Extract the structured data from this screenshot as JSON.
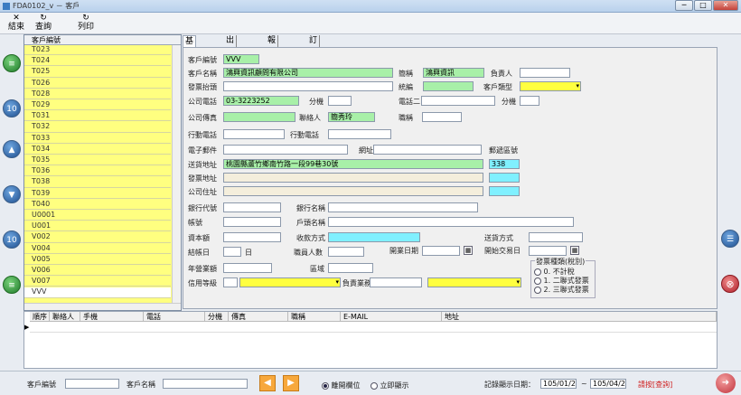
{
  "window": {
    "title": "FDA0102_v － 客戶",
    "min": "─",
    "max": "□",
    "close": "✕"
  },
  "toolbar": [
    {
      "icon": "✕",
      "label": "結束"
    },
    {
      "icon": "↻",
      "label": "查詢"
    },
    {
      "icon": "↻",
      "label": "列印"
    }
  ],
  "list": {
    "header": "客戶編號",
    "rows": [
      "T023",
      "T024",
      "T025",
      "T026",
      "T028",
      "T029",
      "T031",
      "T032",
      "T033",
      "T034",
      "T035",
      "T036",
      "T038",
      "T039",
      "T040",
      "U0001",
      "U001",
      "V002",
      "V004",
      "V005",
      "V006",
      "V007",
      "VVV"
    ]
  },
  "nav_left": {
    "top_label": "≡",
    "prev10_label": "10",
    "prev_label": "▲",
    "next_label": "▼",
    "next10_label": "10",
    "bottom_label": "≡"
  },
  "tabs": [
    "基本資料",
    "出貨記錄",
    "報價記錄",
    "訂單記錄"
  ],
  "form": {
    "cust_no_label": "客戶編號",
    "cust_no": "VVV",
    "cust_name_label": "客戶名稱",
    "cust_name": "鴻興資訊顧問有限公司",
    "short_label": "簡稱",
    "short": "鴻興資訊",
    "owner_label": "負責人",
    "owner": "",
    "invoice_title_label": "發票抬頭",
    "invoice_title": "",
    "tax_id_label": "統編",
    "tax_id": "",
    "cust_type_label": "客戶類型",
    "cust_type": "",
    "phone_label": "公司電話",
    "phone": "03-3223252",
    "ext_label": "分機",
    "ext": "",
    "phone2_label": "電話二",
    "phone2": "",
    "ext2_label": "分機",
    "ext2": "",
    "fax_label": "公司傳真",
    "fax": "",
    "contact_label": "聯絡人",
    "contact": "簡秀玲",
    "title_label": "職稱",
    "title": "",
    "mobile_label": "行動電話",
    "mobile": "",
    "mobile2_label": "行動電話",
    "mobile2": "",
    "email_label": "電子郵件",
    "email": "",
    "website_label": "網址",
    "website": "",
    "postal_label": "郵遞區號",
    "ship_addr_label": "送貨地址",
    "ship_addr": "桃園縣蘆竹鄉南竹路一段99巷30號",
    "ship_zip": "338",
    "inv_addr_label": "發票地址",
    "inv_addr": "",
    "inv_zip": "",
    "co_addr_label": "公司住址",
    "co_addr": "",
    "co_zip": "",
    "bank_code_label": "銀行代號",
    "bank_code": "",
    "bank_name_label": "銀行名稱",
    "bank_name": "",
    "account_label": "帳號",
    "account": "",
    "account_name_label": "戶頭名稱",
    "account_name": "",
    "capital_label": "資本額",
    "capital": "",
    "payment_label": "收款方式",
    "payment": "",
    "delivery_label": "送貨方式",
    "delivery": "",
    "closing_label": "結帳日",
    "closing": "",
    "day_label": "日",
    "staff_label": "職員人數",
    "staff": "",
    "open_date_label": "開業日期",
    "open_date": "",
    "start_trade_label": "開始交易日",
    "start_trade": "",
    "revenue_label": "年營業額",
    "revenue": "",
    "region_label": "區域",
    "region": "",
    "credit_label": "信用等級",
    "credit": "",
    "sales_label": "負責業務",
    "sales": "",
    "invoice_type": {
      "title": "發票種類(稅別)",
      "options": [
        "0. 不計稅",
        "1. 二聯式發票",
        "2. 三聯式發票"
      ]
    }
  },
  "contacts_header": [
    "順序",
    "聯絡人",
    "手機",
    "電話",
    "分機",
    "傳真",
    "職稱",
    "E-MAIL",
    "地址"
  ],
  "bottom": {
    "cust_no_label": "客戶編號",
    "cust_no": "",
    "cust_name_label": "客戶名稱",
    "cust_name": "",
    "prev": "◀",
    "next": "▶",
    "radio1": "離開欄位",
    "radio2": "立即顯示",
    "record_date_label": "記錄顯示日期：",
    "date_from": "105/01/23",
    "tilde": "~",
    "date_to": "105/04/23",
    "hint": "請按[查詢]"
  }
}
